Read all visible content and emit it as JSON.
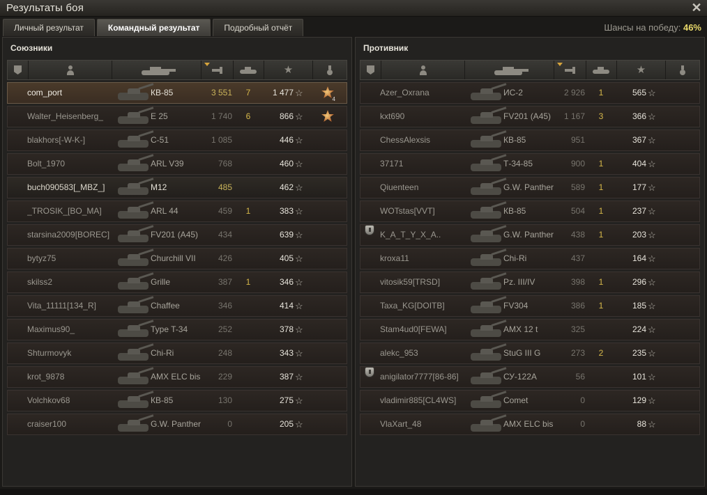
{
  "window": {
    "title": "Результаты боя",
    "close_icon": "close-icon"
  },
  "tabs": [
    {
      "label": "Личный результат",
      "active": false
    },
    {
      "label": "Командный результат",
      "active": true
    },
    {
      "label": "Подробный отчёт",
      "active": false
    }
  ],
  "win_chance": {
    "label": "Шансы на победу:",
    "value": "46%"
  },
  "columns": {
    "icons": [
      "badge-icon",
      "player-icon",
      "tank-icon",
      "damage-icon",
      "kills-icon",
      "xp-star-icon",
      "medal-icon"
    ],
    "sorted_column": "damage"
  },
  "allies": {
    "title": "Союзники",
    "rows": [
      {
        "name": "com_port",
        "tank": "КВ-85",
        "damage": "3 551",
        "kills": "7",
        "xp": "1 477",
        "medal": "4",
        "self": true
      },
      {
        "name": "Walter_Heisenberg_",
        "tank": "E 25",
        "damage": "1 740",
        "kills": "6",
        "xp": "866",
        "medal": "",
        "medal_shown": true
      },
      {
        "name": "blakhors[-W-K-]",
        "tank": "C-51",
        "damage": "1 085",
        "kills": "",
        "xp": "446"
      },
      {
        "name": "Bolt_1970",
        "tank": "ARL V39",
        "damage": "768",
        "kills": "",
        "xp": "460"
      },
      {
        "name": "buch090583[_MBZ_]",
        "tank": "M12",
        "damage": "485",
        "kills": "",
        "xp": "462",
        "platoon": true
      },
      {
        "name": "_TROSIK_[BO_MA]",
        "tank": "ARL 44",
        "damage": "459",
        "kills": "1",
        "xp": "383"
      },
      {
        "name": "starsina2009[BOREC]",
        "tank": "FV201 (A45)",
        "damage": "434",
        "kills": "",
        "xp": "639"
      },
      {
        "name": "bytyz75",
        "tank": "Churchill VII",
        "damage": "426",
        "kills": "",
        "xp": "405"
      },
      {
        "name": "skilss2",
        "tank": "Grille",
        "damage": "387",
        "kills": "1",
        "xp": "346"
      },
      {
        "name": "Vita_11111[134_R]",
        "tank": "Chaffee",
        "damage": "346",
        "kills": "",
        "xp": "414"
      },
      {
        "name": "Maximus90_",
        "tank": "Type T-34",
        "damage": "252",
        "kills": "",
        "xp": "378"
      },
      {
        "name": "Shturmovyk",
        "tank": "Chi-Ri",
        "damage": "248",
        "kills": "",
        "xp": "343"
      },
      {
        "name": "krot_9878",
        "tank": "AMX ELC bis",
        "damage": "229",
        "kills": "",
        "xp": "387"
      },
      {
        "name": "Volchkov68",
        "tank": "КВ-85",
        "damage": "130",
        "kills": "",
        "xp": "275"
      },
      {
        "name": "craiser100",
        "tank": "G.W. Panther",
        "damage": "0",
        "kills": "",
        "xp": "205"
      }
    ]
  },
  "enemies": {
    "title": "Противник",
    "rows": [
      {
        "name": "Azer_Oxrana",
        "tank": "ИС-2",
        "damage": "2 926",
        "kills": "1",
        "xp": "565"
      },
      {
        "name": "kxt690",
        "tank": "FV201 (A45)",
        "damage": "1 167",
        "kills": "3",
        "xp": "366"
      },
      {
        "name": "ChessAlexsis",
        "tank": "КВ-85",
        "damage": "951",
        "kills": "",
        "xp": "367"
      },
      {
        "name": "37171",
        "tank": "Т-34-85",
        "damage": "900",
        "kills": "1",
        "xp": "404"
      },
      {
        "name": "Qiuenteen",
        "tank": "G.W. Panther",
        "damage": "589",
        "kills": "1",
        "xp": "177"
      },
      {
        "name": "WOTstas[VVT]",
        "tank": "КВ-85",
        "damage": "504",
        "kills": "1",
        "xp": "237"
      },
      {
        "name": "K_A_T_Y_X_A..",
        "tank": "G.W. Panther",
        "damage": "438",
        "kills": "1",
        "xp": "203",
        "badge": true
      },
      {
        "name": "kroxa11",
        "tank": "Chi-Ri",
        "damage": "437",
        "kills": "",
        "xp": "164"
      },
      {
        "name": "vitosik59[TRSD]",
        "tank": "Pz. III/IV",
        "damage": "398",
        "kills": "1",
        "xp": "296"
      },
      {
        "name": "Taxa_KG[DOITB]",
        "tank": "FV304",
        "damage": "386",
        "kills": "1",
        "xp": "185"
      },
      {
        "name": "Stam4ud0[FEWA]",
        "tank": "AMX 12 t",
        "damage": "325",
        "kills": "",
        "xp": "224"
      },
      {
        "name": "alekc_953",
        "tank": "StuG III G",
        "damage": "273",
        "kills": "2",
        "xp": "235"
      },
      {
        "name": "anigilator7777[86-86]",
        "tank": "СУ-122А",
        "damage": "56",
        "kills": "",
        "xp": "101",
        "badge": true
      },
      {
        "name": "vladimir885[CL4WS]",
        "tank": "Comet",
        "damage": "0",
        "kills": "",
        "xp": "129"
      },
      {
        "name": "VlaXart_48",
        "tank": "AMX ELC bis",
        "damage": "0",
        "kills": "",
        "xp": "88"
      }
    ]
  },
  "star_glyph": "☆"
}
